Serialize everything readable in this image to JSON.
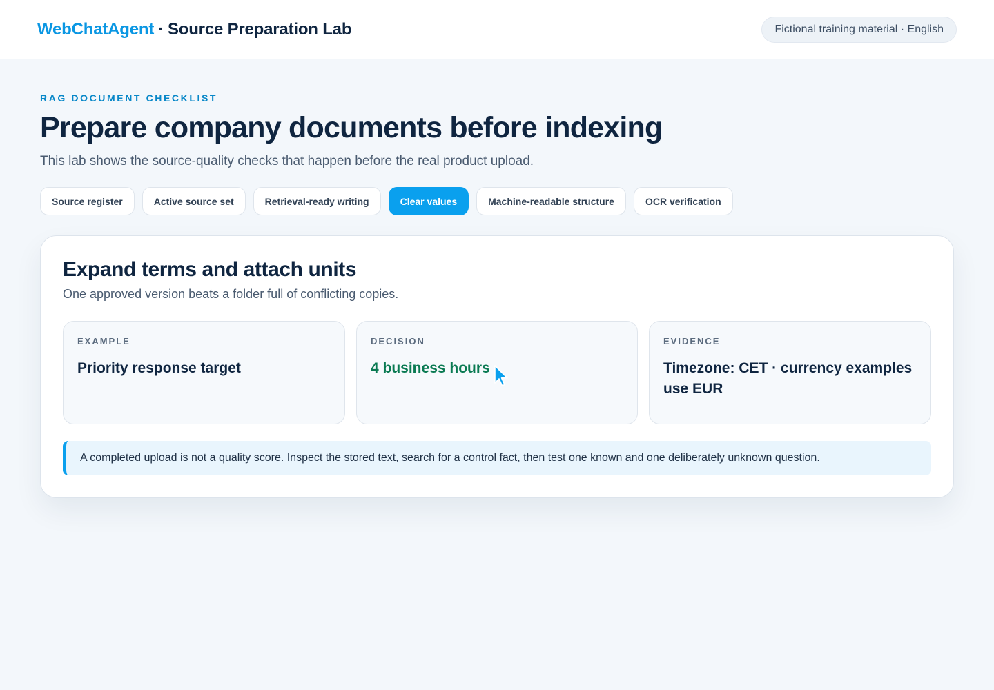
{
  "header": {
    "brand_name": "WebChatAgent",
    "brand_separator": "·",
    "brand_title": "Source Preparation Lab",
    "badge": "Fictional training material · English"
  },
  "intro": {
    "eyebrow": "RAG DOCUMENT CHECKLIST",
    "title": "Prepare company documents before indexing",
    "subtitle": "This lab shows the source-quality checks that happen before the real product upload."
  },
  "tabs": [
    {
      "label": "Source register",
      "active": false
    },
    {
      "label": "Active source set",
      "active": false
    },
    {
      "label": "Retrieval-ready writing",
      "active": false
    },
    {
      "label": "Clear values",
      "active": true
    },
    {
      "label": "Machine-readable structure",
      "active": false
    },
    {
      "label": "OCR verification",
      "active": false
    }
  ],
  "panel": {
    "title": "Expand terms and attach units",
    "subtitle": "One approved version beats a folder full of conflicting copies.",
    "boxes": [
      {
        "label": "EXAMPLE",
        "value": "Priority response target"
      },
      {
        "label": "DECISION",
        "value": "4 business hours"
      },
      {
        "label": "EVIDENCE",
        "value": "Timezone: CET · currency examples use EUR"
      }
    ],
    "note": "A completed upload is not a quality score. Inspect the stored text, search for a control fact, then test one known and one deliberately unknown question."
  },
  "colors": {
    "accent": "#0aa0ee",
    "brand": "#0b97e3",
    "decision": "#0a7a52",
    "ink": "#0f2540"
  },
  "icons": {
    "pointer": "mouse-pointer-icon"
  }
}
